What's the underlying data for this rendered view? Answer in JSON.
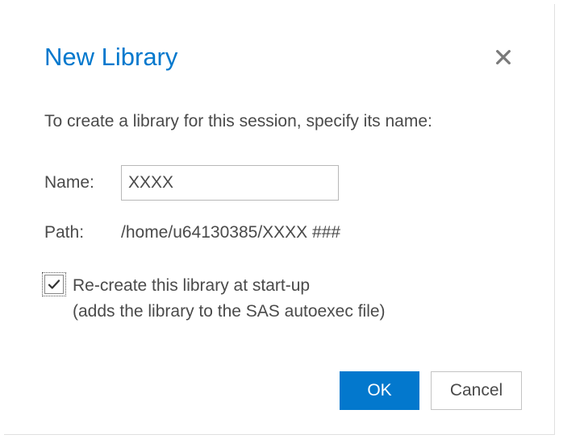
{
  "dialog": {
    "title": "New Library",
    "description": "To create a library for this session, specify its name:",
    "name_label": "Name:",
    "name_value": "XXXX",
    "path_label": "Path:",
    "path_value": "/home/u64130385/XXXX ###",
    "checkbox_checked": true,
    "checkbox_line1": "Re-create this library at start-up",
    "checkbox_line2": "(adds the library to the SAS autoexec file)",
    "ok_label": "OK",
    "cancel_label": "Cancel"
  }
}
